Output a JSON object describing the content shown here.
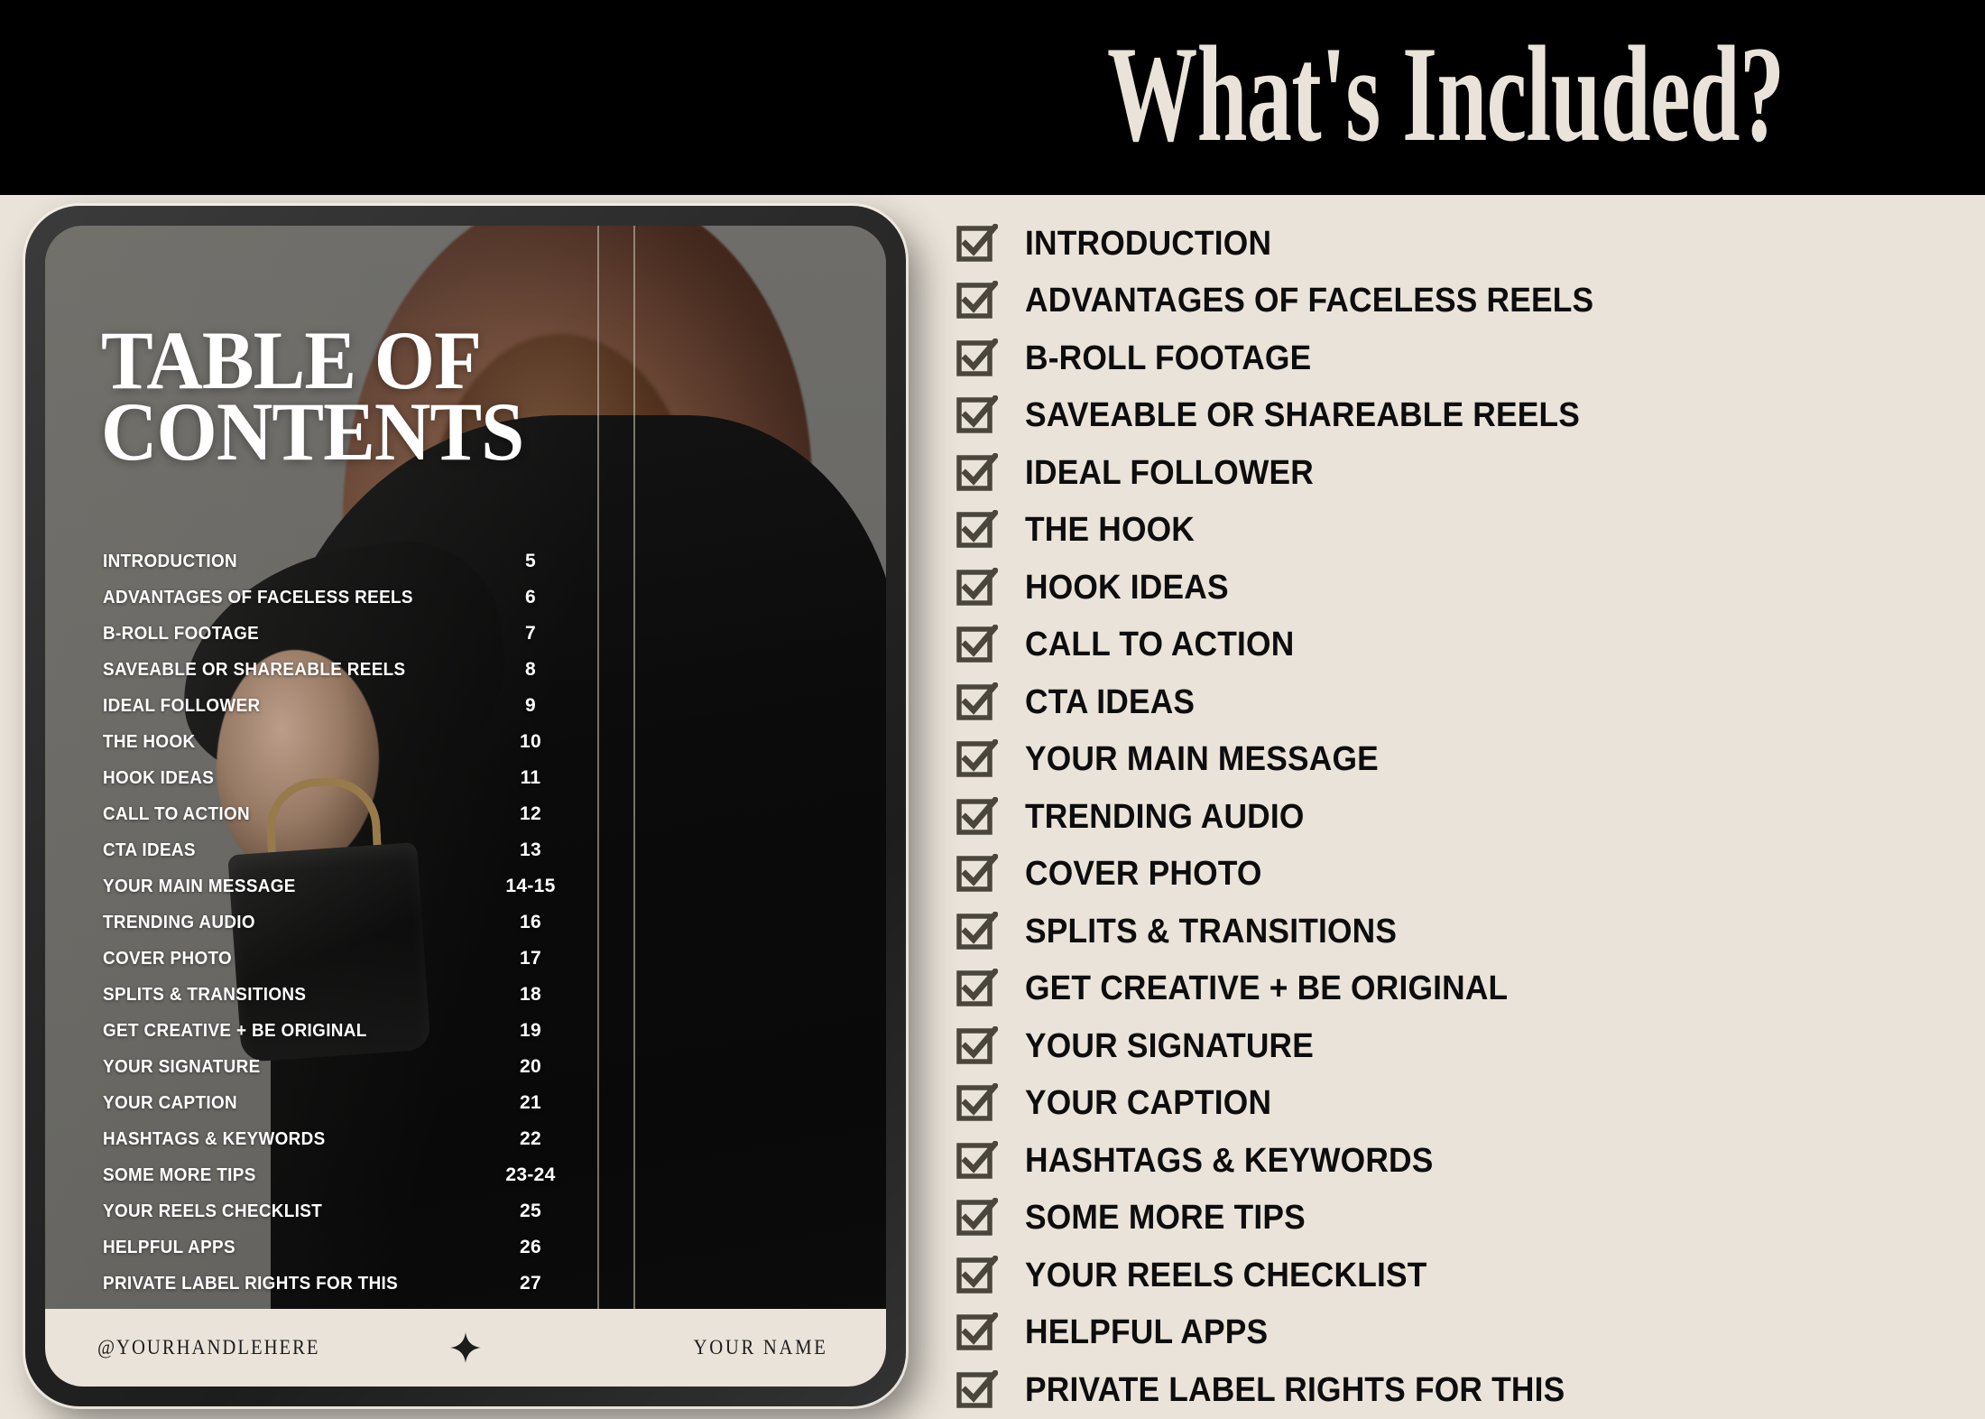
{
  "header": {
    "title": "What's Included?",
    "background_color": "#000000",
    "title_color": "#EAE3D9"
  },
  "page": {
    "background_color": "#EAE3D9"
  },
  "tablet": {
    "toc_heading_line1": "TABLE OF",
    "toc_heading_line2": "CONTENTS",
    "toc_entries": [
      {
        "label": "INTRODUCTION",
        "page": "5"
      },
      {
        "label": "ADVANTAGES OF FACELESS REELS",
        "page": "6"
      },
      {
        "label": "B-ROLL FOOTAGE",
        "page": "7"
      },
      {
        "label": "SAVEABLE OR SHAREABLE REELS",
        "page": "8"
      },
      {
        "label": "IDEAL FOLLOWER",
        "page": "9"
      },
      {
        "label": "THE HOOK",
        "page": "10"
      },
      {
        "label": "HOOK IDEAS",
        "page": "11"
      },
      {
        "label": "CALL TO ACTION",
        "page": "12"
      },
      {
        "label": "CTA IDEAS",
        "page": "13"
      },
      {
        "label": "YOUR MAIN MESSAGE",
        "page": "14-15"
      },
      {
        "label": "TRENDING AUDIO",
        "page": "16"
      },
      {
        "label": "COVER PHOTO",
        "page": "17"
      },
      {
        "label": "SPLITS & TRANSITIONS",
        "page": "18"
      },
      {
        "label": "GET CREATIVE + BE ORIGINAL",
        "page": "19"
      },
      {
        "label": "YOUR SIGNATURE",
        "page": "20"
      },
      {
        "label": "YOUR CAPTION",
        "page": "21"
      },
      {
        "label": "HASHTAGS & KEYWORDS",
        "page": "22"
      },
      {
        "label": "SOME MORE TIPS",
        "page": "23-24"
      },
      {
        "label": "YOUR REELS CHECKLIST",
        "page": "25"
      },
      {
        "label": "HELPFUL APPS",
        "page": "26"
      },
      {
        "label": "PRIVATE LABEL RIGHTS FOR THIS",
        "page": "27"
      }
    ],
    "footer": {
      "handle": "@YOURHANDLEHERE",
      "star_icon": "four-point-sparkle-icon",
      "name": "YOUR NAME",
      "background_color": "#EAE3D9"
    }
  },
  "checklist": {
    "checkbox_icon": "checked-checkbox-icon",
    "checkbox_color": "#4A463E",
    "label_color": "#0D0D0D",
    "items": [
      {
        "label": "INTRODUCTION"
      },
      {
        "label": "ADVANTAGES OF FACELESS REELS"
      },
      {
        "label": "B-ROLL FOOTAGE"
      },
      {
        "label": "SAVEABLE OR SHAREABLE REELS"
      },
      {
        "label": "IDEAL FOLLOWER"
      },
      {
        "label": "THE HOOK"
      },
      {
        "label": "HOOK IDEAS"
      },
      {
        "label": "CALL TO ACTION"
      },
      {
        "label": "CTA IDEAS"
      },
      {
        "label": "YOUR MAIN MESSAGE"
      },
      {
        "label": "TRENDING AUDIO"
      },
      {
        "label": "COVER PHOTO"
      },
      {
        "label": "SPLITS & TRANSITIONS"
      },
      {
        "label": "GET CREATIVE + BE ORIGINAL"
      },
      {
        "label": "YOUR SIGNATURE"
      },
      {
        "label": "YOUR CAPTION"
      },
      {
        "label": "HASHTAGS & KEYWORDS"
      },
      {
        "label": "SOME MORE TIPS"
      },
      {
        "label": "YOUR REELS CHECKLIST"
      },
      {
        "label": "HELPFUL APPS"
      },
      {
        "label": "PRIVATE LABEL RIGHTS FOR THIS"
      }
    ]
  }
}
